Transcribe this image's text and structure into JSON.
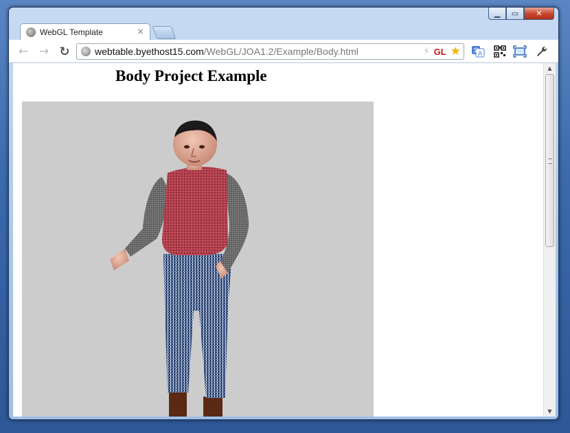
{
  "window": {
    "controls": {
      "minimize_icon": "minimize-icon",
      "maximize_icon": "maximize-icon",
      "close_icon": "close-icon"
    }
  },
  "tabs": [
    {
      "title": "WebGL Template",
      "close_glyph": "×"
    }
  ],
  "toolbar": {
    "back_glyph": "←",
    "forward_glyph": "→",
    "reload_glyph": "↻",
    "url_host": "webtable.byethost15.com",
    "url_path": "/WebGL/JOA1.2/Example/Body.html",
    "gl_badge": "GL",
    "star_glyph": "★",
    "wrench_glyph": "🔧"
  },
  "page": {
    "heading": "Body Project Example"
  },
  "scrollbar": {
    "up_glyph": "▲",
    "down_glyph": "▼"
  }
}
